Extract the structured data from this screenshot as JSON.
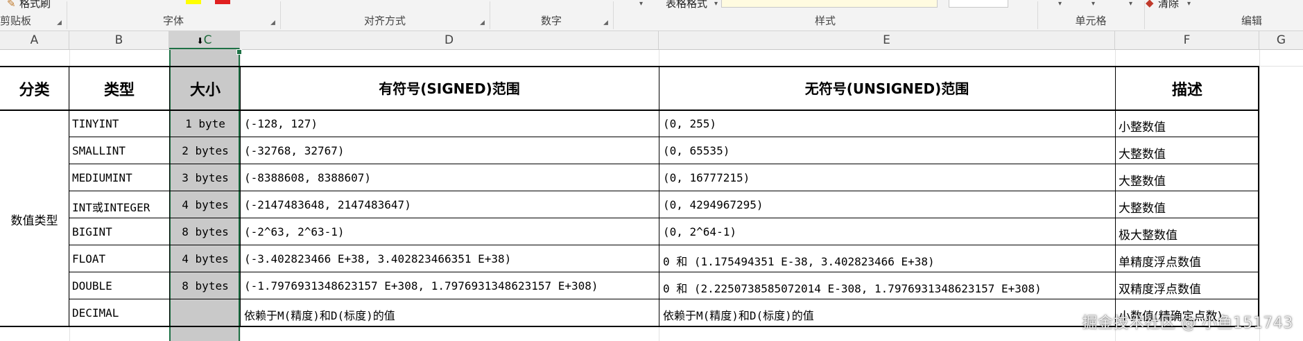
{
  "ribbon": {
    "format_painter_label": "格式刷",
    "groups": {
      "clipboard": "剪贴板",
      "font": "字体",
      "alignment": "对齐方式",
      "number": "数字",
      "styles": "样式",
      "cells": "单元格",
      "editing": "编辑"
    },
    "table_format_label": "表格格式",
    "clear_label": "清除"
  },
  "columns": [
    "A",
    "B",
    "C",
    "D",
    "E",
    "F",
    "G"
  ],
  "table": {
    "headers": {
      "category": "分类",
      "type": "类型",
      "size": "大小",
      "signed": "有符号(SIGNED)范围",
      "unsigned": "无符号(UNSIGNED)范围",
      "description": "描述"
    },
    "category_value": "数值类型",
    "rows": [
      {
        "type": "TINYINT",
        "size": "1 byte",
        "signed": "(-128, 127)",
        "unsigned": "(0, 255)",
        "desc": "小整数值"
      },
      {
        "type": "SMALLINT",
        "size": "2 bytes",
        "signed": "(-32768, 32767)",
        "unsigned": "(0, 65535)",
        "desc": "大整数值"
      },
      {
        "type": "MEDIUMINT",
        "size": "3 bytes",
        "signed": "(-8388608, 8388607)",
        "unsigned": "(0, 16777215)",
        "desc": "大整数值"
      },
      {
        "type": "INT或INTEGER",
        "size": "4 bytes",
        "signed": "(-2147483648, 2147483647)",
        "unsigned": "(0, 4294967295)",
        "desc": "大整数值"
      },
      {
        "type": "BIGINT",
        "size": "8 bytes",
        "signed": "(-2^63, 2^63-1)",
        "unsigned": "(0, 2^64-1)",
        "desc": "极大整数值"
      },
      {
        "type": "FLOAT",
        "size": "4 bytes",
        "signed": "(-3.402823466 E+38, 3.402823466351 E+38)",
        "unsigned": "0 和 (1.175494351 E-38, 3.402823466 E+38)",
        "desc": "单精度浮点数值"
      },
      {
        "type": "DOUBLE",
        "size": "8 bytes",
        "signed": "(-1.7976931348623157 E+308, 1.7976931348623157 E+308)",
        "unsigned": "0 和 (2.2250738585072014 E-308, 1.7976931348623157 E+308)",
        "desc": "双精度浮点数值"
      },
      {
        "type": "DECIMAL",
        "size": "",
        "signed": "依赖于M(精度)和D(标度)的值",
        "unsigned": "依赖于M(精度)和D(标度)的值",
        "desc": "小数值(精确定点数)"
      }
    ]
  },
  "watermark": "掘金技术社区 @ 小鱼151743",
  "colors": {
    "selected_column": "#c9c9c9",
    "selection_border": "#1e7145",
    "ribbon_bg": "#f3f3f3",
    "header_bg": "#f0f0f0"
  }
}
